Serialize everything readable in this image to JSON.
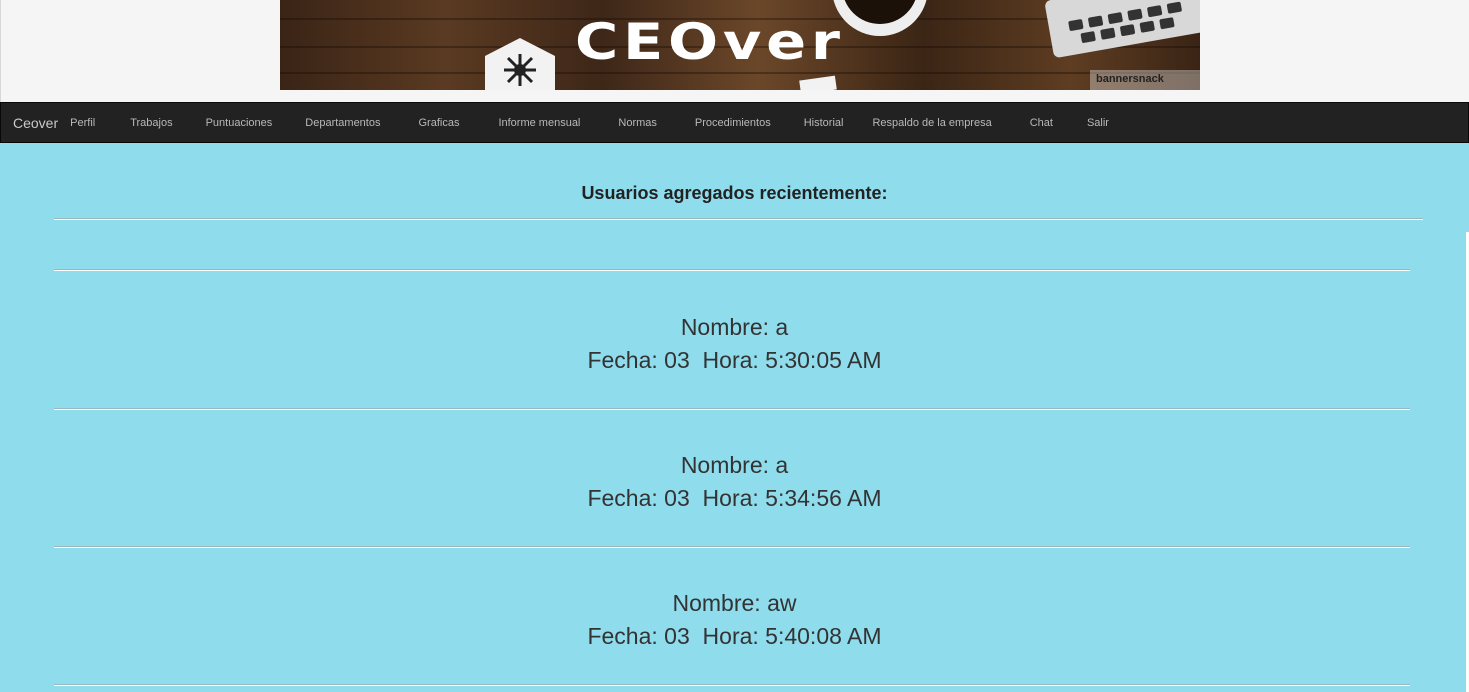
{
  "banner": {
    "logo_text": "CEOver",
    "watermark": "bannersnack"
  },
  "navbar": {
    "brand": "Ceover",
    "items": [
      "Perfil",
      "Trabajos",
      "Puntuaciones",
      "Departamentos",
      "Graficas",
      "Informe mensual",
      "Normas",
      "Procedimientos",
      "Historial",
      "Respaldo de la empresa",
      "Chat",
      "Salir"
    ]
  },
  "main": {
    "heading": "Usuarios agregados recientemente:",
    "entries": [
      {
        "nombre": "Nombre: a",
        "fecha_hora": "Fecha: 03  Hora: 5:30:05 AM"
      },
      {
        "nombre": "Nombre: a",
        "fecha_hora": "Fecha: 03  Hora: 5:34:56 AM"
      },
      {
        "nombre": "Nombre: aw",
        "fecha_hora": "Fecha: 03  Hora: 5:40:08 AM"
      }
    ]
  },
  "colors": {
    "background": "#8fdced",
    "navbar": "#222222",
    "nav_text": "#b9b9b9"
  }
}
